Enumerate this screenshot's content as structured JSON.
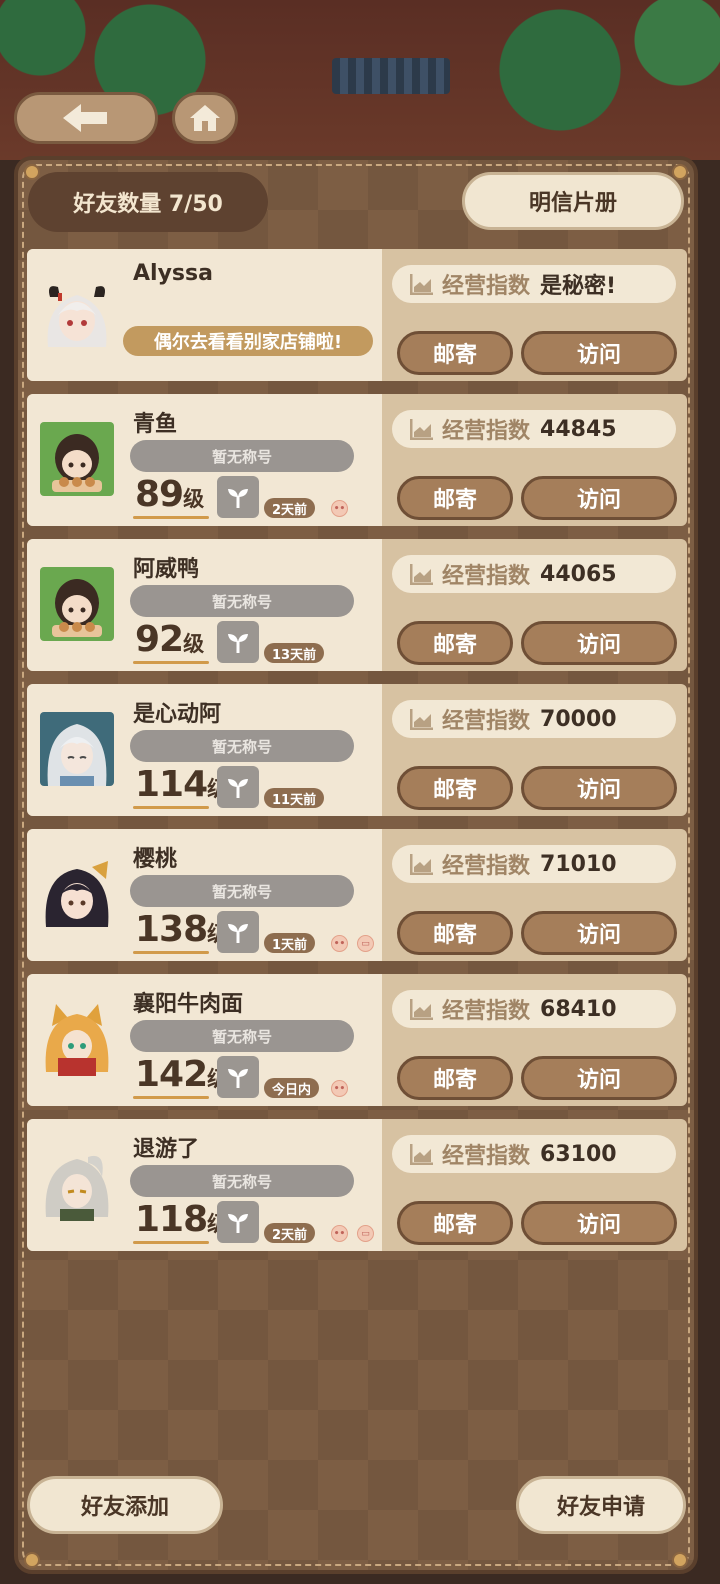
{
  "header": {
    "friend_count_label": "好友数量 7/50",
    "postcard_label": "明信片册"
  },
  "labels": {
    "score": "经营指数",
    "mail": "邮寄",
    "visit": "访问",
    "level_unit": "级"
  },
  "friends": [
    {
      "name": "Alyssa",
      "motto": "偶尔去看看别家店铺啦!",
      "score": "是秘密!",
      "avatar": "white-hair-horns"
    },
    {
      "name": "青鱼",
      "title": "暂无称号",
      "level": "89",
      "time": "2天前",
      "score": "44845",
      "avatar": "brown-hair-green-bg"
    },
    {
      "name": "阿威鸭",
      "title": "暂无称号",
      "level": "92",
      "time": "13天前",
      "score": "44065",
      "avatar": "brown-hair-green-bg"
    },
    {
      "name": "是心动阿",
      "title": "暂无称号",
      "level": "114",
      "time": "11天前",
      "score": "70000",
      "avatar": "silver-hair-teal-bg"
    },
    {
      "name": "樱桃",
      "title": "暂无称号",
      "level": "138",
      "time": "1天前",
      "score": "71010",
      "avatar": "dark-hair-bow"
    },
    {
      "name": "襄阳牛肉面",
      "title": "暂无称号",
      "level": "142",
      "time": "今日内",
      "score": "68410",
      "avatar": "orange-hair-fox-ears"
    },
    {
      "name": "退游了",
      "title": "暂无称号",
      "level": "118",
      "time": "2天前",
      "score": "63100",
      "avatar": "gray-hair-ponytail"
    }
  ],
  "footer": {
    "add_friend_label": "好友添加",
    "requests_label": "好友申请"
  },
  "colors": {
    "panel": "#7d5e44",
    "card_left": "#f2e7d4",
    "card_right": "#d7c2a2",
    "action_button": "#a57e5a",
    "level_underline": "#d19a4a"
  }
}
